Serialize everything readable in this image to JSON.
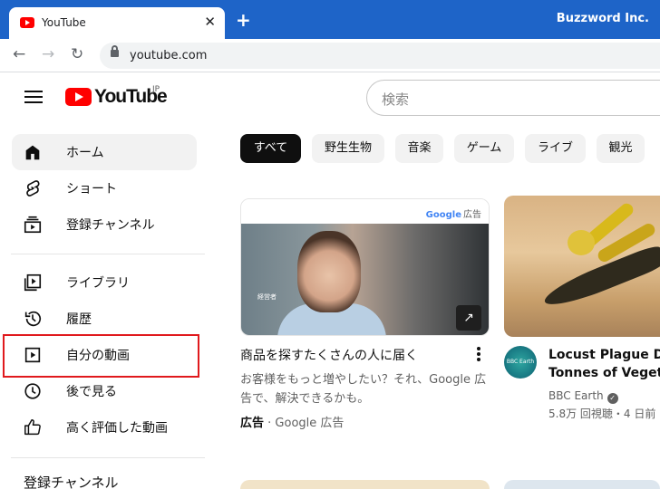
{
  "browser": {
    "tab_title": "YouTube",
    "tab_close": "✕",
    "new_tab": "+",
    "profile": "Buzzword Inc.",
    "url": "youtube.com"
  },
  "header": {
    "logo_text": "YouTube",
    "region": "JP",
    "search_placeholder": "検索"
  },
  "sidebar": {
    "items": [
      {
        "label": "ホーム",
        "icon": "home-icon",
        "active": true
      },
      {
        "label": "ショート",
        "icon": "shorts-icon"
      },
      {
        "label": "登録チャンネル",
        "icon": "subscriptions-icon"
      },
      {
        "label": "ライブラリ",
        "icon": "library-icon"
      },
      {
        "label": "履歴",
        "icon": "history-icon"
      },
      {
        "label": "自分の動画",
        "icon": "your-videos-icon",
        "highlighted": true
      },
      {
        "label": "後で見る",
        "icon": "watch-later-icon"
      },
      {
        "label": "高く評価した動画",
        "icon": "liked-videos-icon"
      }
    ],
    "section_title": "登録チャンネル"
  },
  "chips": [
    "すべて",
    "野生生物",
    "音楽",
    "ゲーム",
    "ライブ",
    "観光"
  ],
  "ad_card": {
    "brand": "Google",
    "brand_tag": "広告",
    "image_caption": "経営者",
    "title": "商品を探すたくさんの人に届く",
    "description": "お客様をもっと増やしたい？それ、Google 広告で、解決できるかも。",
    "meta_bold": "広告",
    "meta_rest": " · Google 広告"
  },
  "video_card": {
    "avatar_text": "BBC Earth",
    "title_line1": "Locust Plague Devo",
    "title_line2": "Tonnes of Vegetatio",
    "channel": "BBC Earth",
    "stats": "5.8万 回視聴・4 日前"
  },
  "colors": {
    "browser_blue": "#1e64c8",
    "brand_red": "#ff0000",
    "highlight_red": "#e0191d",
    "chip_selected": "#0f0f0f"
  }
}
